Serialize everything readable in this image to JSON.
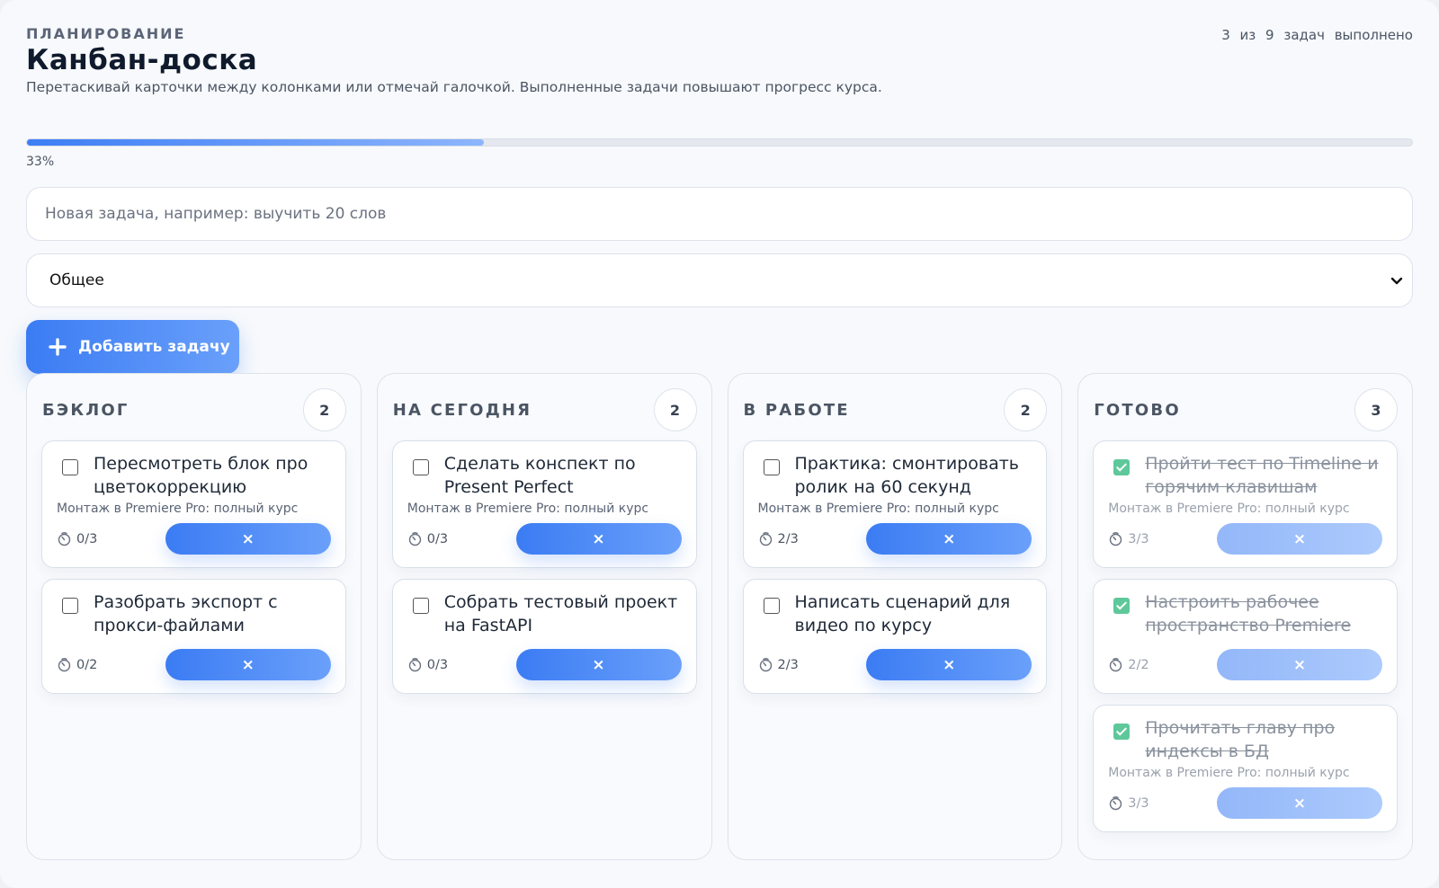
{
  "header": {
    "eyebrow": "ПЛАНИРОВАНИЕ",
    "title": "Канбан-доска",
    "subtitle": "Перетаскивай карточки между колонками или отмечай галочкой. Выполненные задачи повышают прогресс курса.",
    "done_count": "3 из 9 задач выполнено"
  },
  "progress": {
    "percent": 33,
    "label": "33%"
  },
  "new_task": {
    "placeholder": "Новая задача, например: выучить 20 слов",
    "value": ""
  },
  "category_select": {
    "selected": "Общее",
    "icon": "chevron-down-icon"
  },
  "add_button": {
    "label": "Добавить задачу",
    "icon": "plus-icon"
  },
  "colors": {
    "accent": "#3b7cf3",
    "accent_light": "#6aa0fb",
    "done_check": "#5fc89a"
  },
  "columns": [
    {
      "title": "Бэклог",
      "count": "2",
      "cards": [
        {
          "title": "Пересмотреть блок про цветокоррекцию",
          "course": "Монтаж в Premiere Pro: полный курс",
          "pomodoros": "0/3",
          "done": false,
          "delete_label": "×"
        },
        {
          "title": "Разобрать экспорт с прокси-файлами",
          "course": "",
          "pomodoros": "0/2",
          "done": false,
          "delete_label": "×"
        }
      ]
    },
    {
      "title": "На сегодня",
      "count": "2",
      "cards": [
        {
          "title": "Сделать конспект по Present Perfect",
          "course": "Монтаж в Premiere Pro: полный курс",
          "pomodoros": "0/3",
          "done": false,
          "delete_label": "×"
        },
        {
          "title": "Собрать тестовый проект на FastAPI",
          "course": "",
          "pomodoros": "0/3",
          "done": false,
          "delete_label": "×"
        }
      ]
    },
    {
      "title": "В работе",
      "count": "2",
      "cards": [
        {
          "title": "Практика: смонтировать ролик на 60 секунд",
          "course": "Монтаж в Premiere Pro: полный курс",
          "pomodoros": "2/3",
          "done": false,
          "delete_label": "×"
        },
        {
          "title": "Написать сценарий для видео по курсу",
          "course": "",
          "pomodoros": "2/3",
          "done": false,
          "delete_label": "×"
        }
      ]
    },
    {
      "title": "Готово",
      "count": "3",
      "cards": [
        {
          "title": "Пройти тест по Timeline и горячим клавишам",
          "course": "Монтаж в Premiere Pro: полный курс",
          "pomodoros": "3/3",
          "done": true,
          "delete_label": "×"
        },
        {
          "title": "Настроить рабочее пространство Premiere",
          "course": "",
          "pomodoros": "2/2",
          "done": true,
          "delete_label": "×"
        },
        {
          "title": "Прочитать главу про индексы в БД",
          "course": "Монтаж в Premiere Pro: полный курс",
          "pomodoros": "3/3",
          "done": true,
          "delete_label": "×"
        }
      ]
    }
  ]
}
